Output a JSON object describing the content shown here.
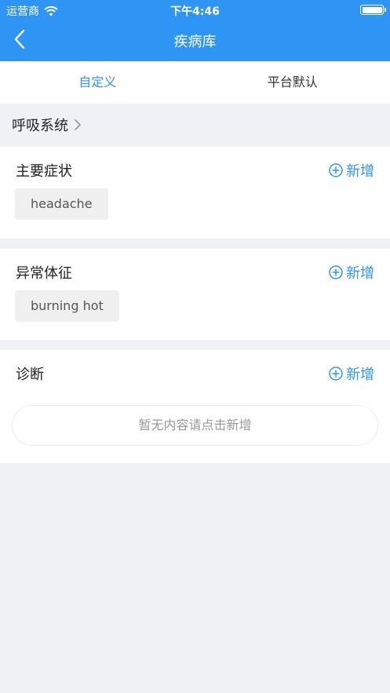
{
  "status_bar": {
    "carrier": "运营商",
    "time": "下午4:46",
    "battery": 1.0
  },
  "nav": {
    "title": "疾病库"
  },
  "tabs": [
    {
      "label": "自定义",
      "active": true
    },
    {
      "label": "平台默认",
      "active": false
    }
  ],
  "category": {
    "label": "呼吸系统"
  },
  "sections": {
    "main_symptoms": {
      "title": "主要症状",
      "add_label": "新增",
      "items": [
        "headache"
      ]
    },
    "abnormal_signs": {
      "title": "异常体征",
      "add_label": "新增",
      "items": [
        "burning hot"
      ]
    },
    "diagnosis": {
      "title": "诊断",
      "add_label": "新增",
      "empty_text": "暂无内容请点击新增"
    }
  },
  "colors": {
    "accent": "#2f95f5",
    "background": "#eff2f5",
    "chip": "#f0f0f0"
  },
  "icons": {
    "back": "chevron-left-icon",
    "category": "chevron-right-icon",
    "add": "plus-circle-icon"
  }
}
